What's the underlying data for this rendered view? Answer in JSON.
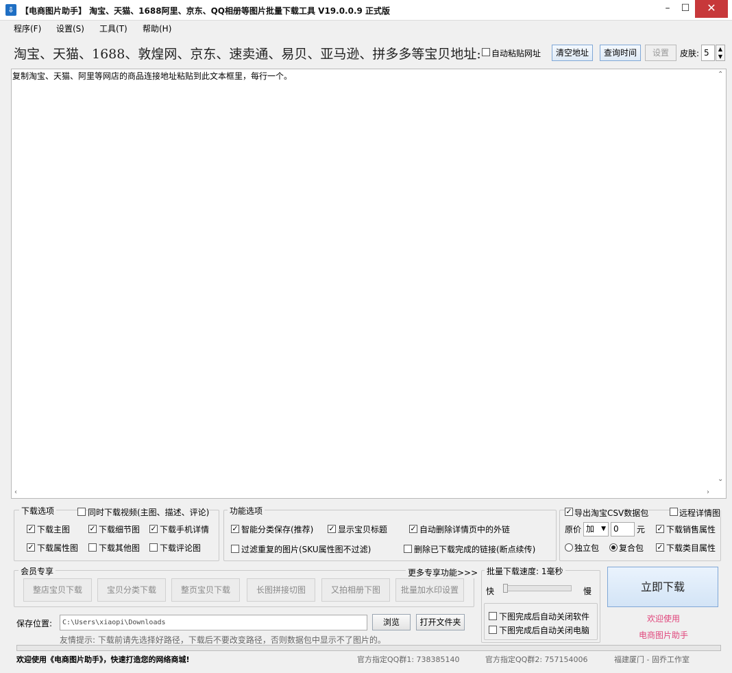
{
  "window": {
    "title": "【电商图片助手】 淘宝、天猫、1688阿里、京东、QQ相册等图片批量下载工具 V19.0.0.9 正式版",
    "icon": "download-app-icon",
    "minimize": "–",
    "maximize": "☐",
    "close": "✕"
  },
  "menu": [
    "程序(F)",
    "设置(S)",
    "工具(T)",
    "帮助(H)"
  ],
  "url_bar": {
    "label": "淘宝、天猫、1688、敦煌网、京东、速卖通、易贝、亚马逊、拼多多等宝贝地址:",
    "auto_paste_label": "自动粘贴网址",
    "auto_paste_checked": false,
    "clear_button": "清空地址",
    "query_time_button": "查询时间",
    "settings_button": "设置",
    "skin_label": "皮肤:",
    "skin_value": "5"
  },
  "url_area": {
    "content": "复制淘宝、天猫、阿里等网店的商品连接地址粘贴到此文本框里，每行一个。"
  },
  "download_options": {
    "title": "下载选项",
    "video_label": "同时下载视频(主图、描述、评论)",
    "video_checked": false,
    "items": [
      {
        "label": "下载主图",
        "checked": true
      },
      {
        "label": "下载细节图",
        "checked": true
      },
      {
        "label": "下载手机详情",
        "checked": true
      },
      {
        "label": "下载属性图",
        "checked": true
      },
      {
        "label": "下载其他图",
        "checked": false
      },
      {
        "label": "下载评论图",
        "checked": false
      }
    ]
  },
  "function_options": {
    "title": "功能选项",
    "items": [
      {
        "label": "智能分类保存(推荐)",
        "checked": true
      },
      {
        "label": "显示宝贝标题",
        "checked": true
      },
      {
        "label": "自动删除详情页中的外链",
        "checked": true
      },
      {
        "label": "过滤重复的图片(SKU属性图不过滤)",
        "checked": false
      },
      {
        "label": "删除已下载完成的链接(断点续传)",
        "checked": false
      }
    ]
  },
  "export_options": {
    "csv_label": "导出淘宝CSV数据包",
    "csv_checked": true,
    "remote_label": "远程详情图",
    "remote_checked": false,
    "price_label": "原价",
    "price_op": "加",
    "price_value": "0",
    "price_unit": "元",
    "sales_attr_label": "下载销售属性",
    "sales_attr_checked": true,
    "single_pack_label": "独立包",
    "single_pack_selected": false,
    "combo_pack_label": "复合包",
    "combo_pack_selected": true,
    "category_attr_label": "下载类目属性",
    "category_attr_checked": true
  },
  "member": {
    "title": "会员专享",
    "more_link": "更多专享功能>>>",
    "buttons": [
      "整店宝贝下载",
      "宝贝分类下载",
      "整页宝贝下载",
      "长图拼接切图",
      "又拍相册下图",
      "批量加水印设置"
    ]
  },
  "speed": {
    "title": "批量下载速度: 1毫秒",
    "fast": "快",
    "slow": "慢",
    "level": 0,
    "close_app_label": "下图完成后自动关闭软件",
    "close_app_checked": false,
    "shutdown_label": "下图完成后自动关闭电脑",
    "shutdown_checked": false
  },
  "save": {
    "label": "保存位置:",
    "path": "C:\\Users\\xiaopi\\Downloads",
    "browse_button": "浏览",
    "open_folder_button": "打开文件夹",
    "tip": "友情提示: 下载前请先选择好路径，下载后不要改变路径，否则数据包中显示不了图片的。"
  },
  "download_button": "立即下载",
  "welcome": {
    "line1": "欢迎使用",
    "line2": "电商图片助手"
  },
  "progress": 0,
  "status": {
    "left": "欢迎使用《电商图片助手》，快速打造您的网络商城!",
    "qq1": "官方指定QQ群1: 738385140",
    "qq2": "官方指定QQ群2: 757154006",
    "studio": "福建厦门 - 固乔工作室"
  }
}
